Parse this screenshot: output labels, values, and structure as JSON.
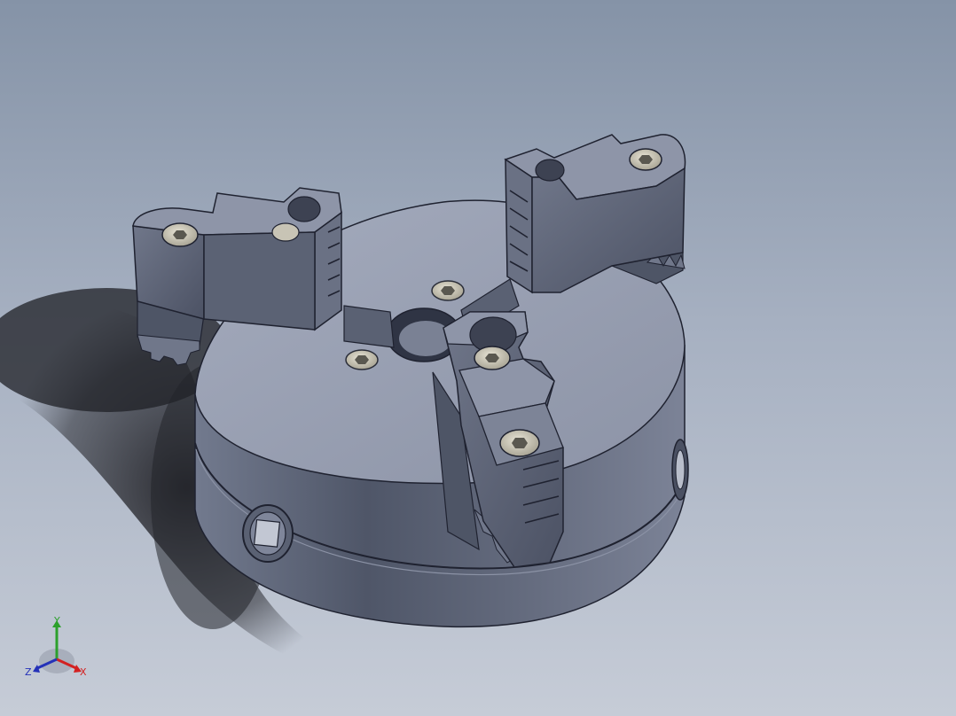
{
  "viewport": {
    "model_name": "three-jaw-chuck",
    "background_top": "#8593a7",
    "background_bottom": "#c6ccd7"
  },
  "model": {
    "body_color": "#61697c",
    "face_color": "#9ca3b6",
    "edge_color": "#1f2230",
    "screw_color": "#cbc7b8"
  },
  "triad": {
    "x_label": "X",
    "y_label": "Y",
    "z_label": "Z",
    "x_color": "#d32121",
    "y_color": "#2ca02c",
    "z_color": "#2431b8"
  }
}
